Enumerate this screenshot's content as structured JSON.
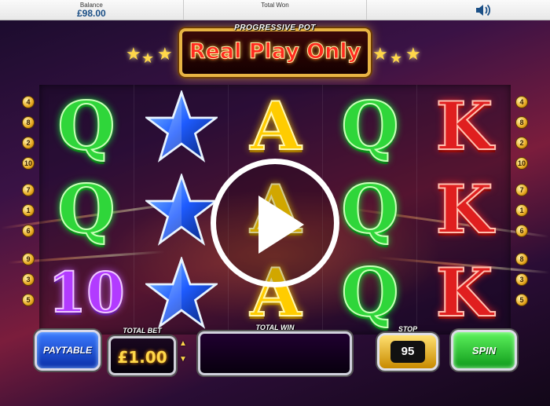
{
  "topbar": {
    "balance_label": "Balance",
    "balance_value": "£98.00",
    "total_won_label": "Total Won",
    "total_won_value": "",
    "sound_icon": "speaker-icon"
  },
  "header": {
    "pot_label": "PROGRESSIVE POT",
    "marquee_text": "Real Play Only"
  },
  "paylines": {
    "left": [
      "4",
      "8",
      "2",
      "10",
      "7",
      "1",
      "6",
      "9",
      "3",
      "5"
    ],
    "right": [
      "4",
      "8",
      "2",
      "10",
      "7",
      "1",
      "6",
      "8",
      "3",
      "5"
    ]
  },
  "reels": [
    [
      "Q",
      "Q",
      "10"
    ],
    [
      "star",
      "star",
      "star"
    ],
    [
      "A",
      "A",
      "A"
    ],
    [
      "Q",
      "Q",
      "Q"
    ],
    [
      "K",
      "K",
      "K"
    ]
  ],
  "overlay": {
    "icon": "play-icon"
  },
  "controls": {
    "paytable_label": "PAYTABLE",
    "total_bet_label": "TOTAL BET",
    "total_bet_value": "£1.00",
    "total_win_label": "TOTAL WIN",
    "total_win_value": "",
    "stop_label": "STOP",
    "stop_value": "95",
    "spin_label": "SPIN"
  },
  "colors": {
    "accent_gold": "#e8b444",
    "q_green": "#2fd63a",
    "a_yellow": "#ffcc00",
    "k_red": "#e01f1f",
    "ten_purple": "#b23bff",
    "star_blue": "#1e5bff"
  }
}
